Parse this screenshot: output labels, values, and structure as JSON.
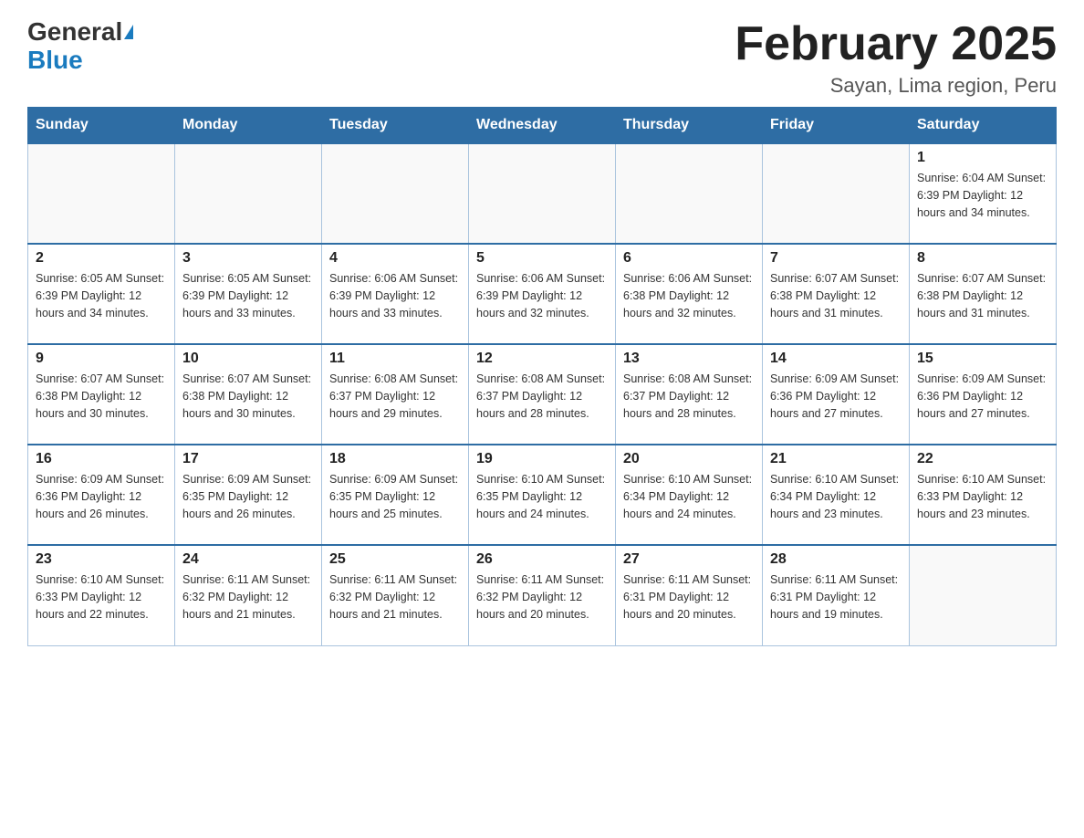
{
  "header": {
    "logo_general": "General",
    "logo_blue": "Blue",
    "month_title": "February 2025",
    "subtitle": "Sayan, Lima region, Peru"
  },
  "days_of_week": [
    "Sunday",
    "Monday",
    "Tuesday",
    "Wednesday",
    "Thursday",
    "Friday",
    "Saturday"
  ],
  "weeks": [
    [
      {
        "day": "",
        "info": ""
      },
      {
        "day": "",
        "info": ""
      },
      {
        "day": "",
        "info": ""
      },
      {
        "day": "",
        "info": ""
      },
      {
        "day": "",
        "info": ""
      },
      {
        "day": "",
        "info": ""
      },
      {
        "day": "1",
        "info": "Sunrise: 6:04 AM\nSunset: 6:39 PM\nDaylight: 12 hours and 34 minutes."
      }
    ],
    [
      {
        "day": "2",
        "info": "Sunrise: 6:05 AM\nSunset: 6:39 PM\nDaylight: 12 hours and 34 minutes."
      },
      {
        "day": "3",
        "info": "Sunrise: 6:05 AM\nSunset: 6:39 PM\nDaylight: 12 hours and 33 minutes."
      },
      {
        "day": "4",
        "info": "Sunrise: 6:06 AM\nSunset: 6:39 PM\nDaylight: 12 hours and 33 minutes."
      },
      {
        "day": "5",
        "info": "Sunrise: 6:06 AM\nSunset: 6:39 PM\nDaylight: 12 hours and 32 minutes."
      },
      {
        "day": "6",
        "info": "Sunrise: 6:06 AM\nSunset: 6:38 PM\nDaylight: 12 hours and 32 minutes."
      },
      {
        "day": "7",
        "info": "Sunrise: 6:07 AM\nSunset: 6:38 PM\nDaylight: 12 hours and 31 minutes."
      },
      {
        "day": "8",
        "info": "Sunrise: 6:07 AM\nSunset: 6:38 PM\nDaylight: 12 hours and 31 minutes."
      }
    ],
    [
      {
        "day": "9",
        "info": "Sunrise: 6:07 AM\nSunset: 6:38 PM\nDaylight: 12 hours and 30 minutes."
      },
      {
        "day": "10",
        "info": "Sunrise: 6:07 AM\nSunset: 6:38 PM\nDaylight: 12 hours and 30 minutes."
      },
      {
        "day": "11",
        "info": "Sunrise: 6:08 AM\nSunset: 6:37 PM\nDaylight: 12 hours and 29 minutes."
      },
      {
        "day": "12",
        "info": "Sunrise: 6:08 AM\nSunset: 6:37 PM\nDaylight: 12 hours and 28 minutes."
      },
      {
        "day": "13",
        "info": "Sunrise: 6:08 AM\nSunset: 6:37 PM\nDaylight: 12 hours and 28 minutes."
      },
      {
        "day": "14",
        "info": "Sunrise: 6:09 AM\nSunset: 6:36 PM\nDaylight: 12 hours and 27 minutes."
      },
      {
        "day": "15",
        "info": "Sunrise: 6:09 AM\nSunset: 6:36 PM\nDaylight: 12 hours and 27 minutes."
      }
    ],
    [
      {
        "day": "16",
        "info": "Sunrise: 6:09 AM\nSunset: 6:36 PM\nDaylight: 12 hours and 26 minutes."
      },
      {
        "day": "17",
        "info": "Sunrise: 6:09 AM\nSunset: 6:35 PM\nDaylight: 12 hours and 26 minutes."
      },
      {
        "day": "18",
        "info": "Sunrise: 6:09 AM\nSunset: 6:35 PM\nDaylight: 12 hours and 25 minutes."
      },
      {
        "day": "19",
        "info": "Sunrise: 6:10 AM\nSunset: 6:35 PM\nDaylight: 12 hours and 24 minutes."
      },
      {
        "day": "20",
        "info": "Sunrise: 6:10 AM\nSunset: 6:34 PM\nDaylight: 12 hours and 24 minutes."
      },
      {
        "day": "21",
        "info": "Sunrise: 6:10 AM\nSunset: 6:34 PM\nDaylight: 12 hours and 23 minutes."
      },
      {
        "day": "22",
        "info": "Sunrise: 6:10 AM\nSunset: 6:33 PM\nDaylight: 12 hours and 23 minutes."
      }
    ],
    [
      {
        "day": "23",
        "info": "Sunrise: 6:10 AM\nSunset: 6:33 PM\nDaylight: 12 hours and 22 minutes."
      },
      {
        "day": "24",
        "info": "Sunrise: 6:11 AM\nSunset: 6:32 PM\nDaylight: 12 hours and 21 minutes."
      },
      {
        "day": "25",
        "info": "Sunrise: 6:11 AM\nSunset: 6:32 PM\nDaylight: 12 hours and 21 minutes."
      },
      {
        "day": "26",
        "info": "Sunrise: 6:11 AM\nSunset: 6:32 PM\nDaylight: 12 hours and 20 minutes."
      },
      {
        "day": "27",
        "info": "Sunrise: 6:11 AM\nSunset: 6:31 PM\nDaylight: 12 hours and 20 minutes."
      },
      {
        "day": "28",
        "info": "Sunrise: 6:11 AM\nSunset: 6:31 PM\nDaylight: 12 hours and 19 minutes."
      },
      {
        "day": "",
        "info": ""
      }
    ]
  ]
}
